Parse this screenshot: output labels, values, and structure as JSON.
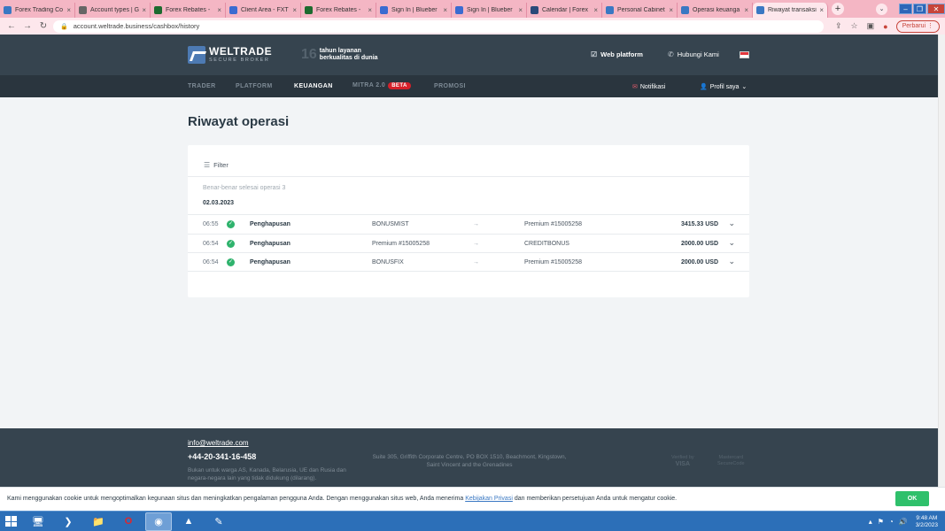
{
  "browser": {
    "tabs": [
      {
        "label": "Forex Trading Co",
        "fav": "#3a78c3"
      },
      {
        "label": "Account types | G",
        "fav": "#666"
      },
      {
        "label": "Forex Rebates -",
        "fav": "#1d6b2f"
      },
      {
        "label": "Client Area - FXT",
        "fav": "#3a6bd1"
      },
      {
        "label": "Forex Rebates -",
        "fav": "#1d6b2f"
      },
      {
        "label": "Sign In | Blueber",
        "fav": "#3a6bd1"
      },
      {
        "label": "Sign In | Blueber",
        "fav": "#3a6bd1"
      },
      {
        "label": "Calendar | Forex",
        "fav": "#2a4a7a"
      },
      {
        "label": "Personal Cabinet",
        "fav": "#3a78c3"
      },
      {
        "label": "Operasi keuanga",
        "fav": "#3a78c3"
      },
      {
        "label": "Riwayat transaksi",
        "fav": "#3a78c3"
      }
    ],
    "url": "account.weltrade.business/cashbox/history",
    "update_label": "Perbarui"
  },
  "header": {
    "brand": "WELTRADE",
    "brand_sub": "SECURE BROKER",
    "years_num": "16",
    "years_line1": "tahun layanan",
    "years_line2": "berkualitas di dunia",
    "web_platform": "Web platform",
    "contact": "Hubungi Kami"
  },
  "nav": {
    "items": [
      "TRADER",
      "PLATFORM",
      "KEUANGAN",
      "MITRA 2.0",
      "PROMOSI"
    ],
    "beta": "BETA",
    "active": "KEUANGAN",
    "notifications": "Notifikasi",
    "profile": "Profil saya"
  },
  "main": {
    "title": "Riwayat operasi",
    "filter_label": "Filter",
    "completed_label": "Benar-benar selesai operasi 3",
    "date": "02.03.2023",
    "rows": [
      {
        "time": "06:55",
        "type": "Penghapusan",
        "from": "BONUSMIST",
        "to": "Premium #15005258",
        "amount": "3415.33 USD"
      },
      {
        "time": "06:54",
        "type": "Penghapusan",
        "from": "Premium #15005258",
        "to": "CREDITBONUS",
        "amount": "2000.00 USD"
      },
      {
        "time": "06:54",
        "type": "Penghapusan",
        "from": "BONUSFIX",
        "to": "Premium #15005258",
        "amount": "2000.00 USD"
      }
    ]
  },
  "footer": {
    "email": "info@weltrade.com",
    "phone": "+44-20-341-16-458",
    "note": "Bukan untuk warga AS, Kanada, Belarusia, UE dan Rusia dan negara-negara lain yang tidak didukung (dilarang).",
    "address": "Suite 305, Griffith Corporate Centre, PO BOX 1510, Beachmont, Kingstown, Saint Vincent and the Grenadines",
    "visa_top": "Verified by",
    "visa_bottom": "VISA",
    "mc_top": "Mastercard",
    "mc_bottom": "SecureCode"
  },
  "cookie": {
    "text_before": "Kami menggunakan cookie untuk mengoptimalkan kegunaan situs dan meningkatkan pengalaman pengguna Anda. Dengan menggunakan situs web, Anda menerima ",
    "link": "Kebijakan Privasi",
    "text_after": " dan memberikan persetujuan Anda untuk mengatur cookie.",
    "ok": "OK"
  },
  "taskbar": {
    "time": "9:48 AM",
    "date": "3/2/2023"
  },
  "colors": {
    "header_bg": "#36444f",
    "nav_bg": "#2a353e",
    "accent_green": "#2fc06b",
    "beta_red": "#d6202a"
  }
}
